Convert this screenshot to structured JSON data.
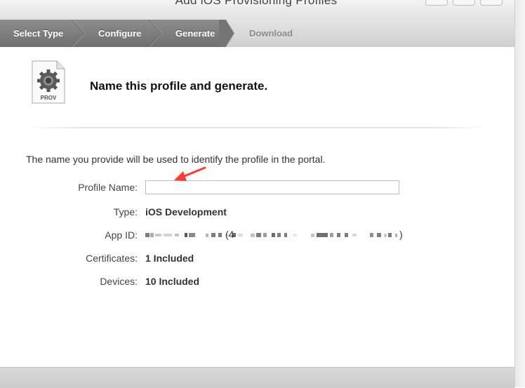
{
  "window": {
    "title": "Add iOS Provisioning Profiles"
  },
  "steps": [
    {
      "label": "Select Type",
      "state": "done"
    },
    {
      "label": "Configure",
      "state": "done"
    },
    {
      "label": "Generate",
      "state": "current"
    },
    {
      "label": "Download",
      "state": "pending"
    }
  ],
  "icon": {
    "name": "provisioning-profile-icon",
    "label": "PROV"
  },
  "main": {
    "heading": "Name this profile and generate.",
    "intro": "The name you provide will be used to identify the profile in the portal.",
    "fields": {
      "profile_name": {
        "label": "Profile Name:",
        "value": "",
        "placeholder": ""
      },
      "type": {
        "label": "Type:",
        "value": "iOS Development"
      },
      "app_id": {
        "label": "App ID:",
        "value": "(redacted)"
      },
      "certificates": {
        "label": "Certificates:",
        "value": "1 Included"
      },
      "devices": {
        "label": "Devices:",
        "value": "10 Included"
      }
    }
  },
  "annotation": {
    "type": "red-arrow",
    "color": "#ff3b2f"
  },
  "colors": {
    "step_active_bg": "#7d7d7d",
    "step_inactive_bg": "#d8d8d8",
    "step_active_text": "#ffffff",
    "step_inactive_text": "#8a8a8a"
  }
}
